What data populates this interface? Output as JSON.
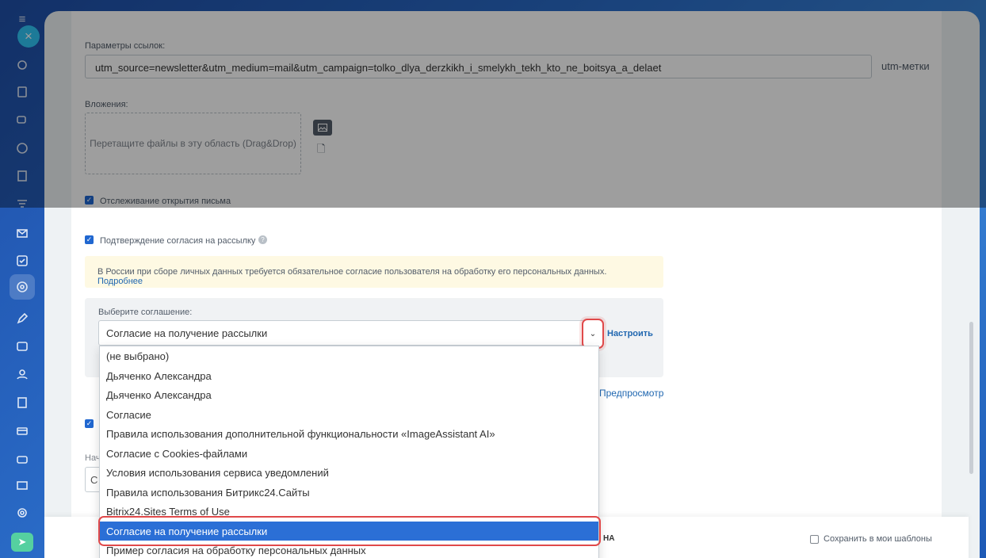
{
  "links_params": {
    "label": "Параметры ссылок:",
    "value": "utm_source=newsletter&utm_medium=mail&utm_campaign=tolko_dlya_derzkikh_i_smelykh_tekh_kto_ne_boitsya_a_delaet",
    "utm_link": "utm-метки"
  },
  "attachments": {
    "label": "Вложения:",
    "dropzone_text": "Перетащите файлы в эту область (Drag&Drop)"
  },
  "tracking": {
    "label": "Отслеживание открытия письма"
  },
  "consent": {
    "label": "Подтверждение согласия на рассылку",
    "help_icon": "?",
    "notice_text": "В России при сборе личных данных требуется обязательное согласие пользователя на обработку его персональных данных.",
    "notice_link": "Подробнее",
    "select_label": "Выберите соглашение:",
    "selected_value": "Согласие на получение рассылки",
    "setup_link": "Настроить",
    "preview_link": "Предпросмотр"
  },
  "dropdown_options": [
    "(не выбрано)",
    "Дьяченко Александра",
    "Дьяченко Александра",
    "Согласие",
    "Правила использования дополнительной функциональности «ImageAssistant AI»",
    "Согласие с Cookies-файлами",
    "Условия использования сервиса уведомлений",
    "Правила использования Битрикс24.Сайты",
    "Bitrix24.Sites Terms of Use",
    "Согласие на получение рассылки",
    "Пример согласия на обработку персональных данных"
  ],
  "partial": {
    "label_fragment": "Нач",
    "field_fragment": "С",
    "bottom_fragment": "НА"
  },
  "footer": {
    "save_template": "Сохранить в мои шаблоны"
  },
  "colors": {
    "accent": "#2b6fd6",
    "highlight": "#e0494a",
    "rail_close": "#2fc6f6"
  }
}
